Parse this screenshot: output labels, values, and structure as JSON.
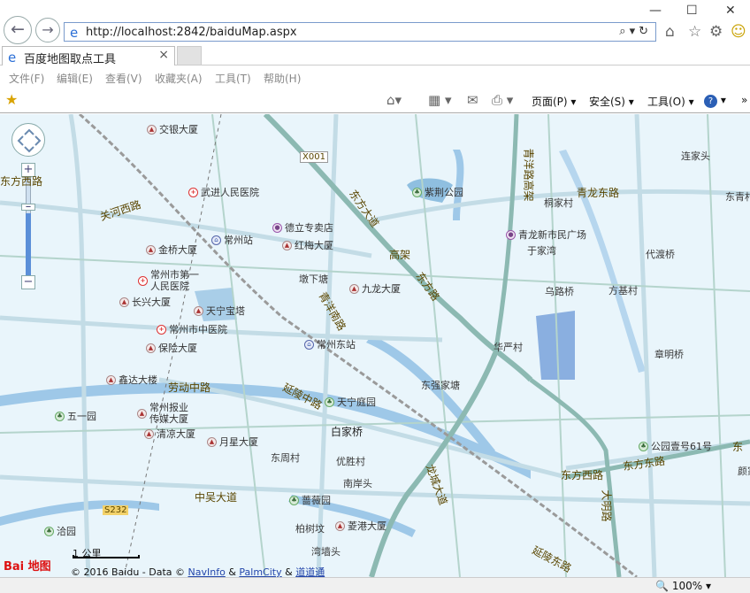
{
  "browser": {
    "url": "http://localhost:2842/baiduMap.aspx",
    "tab_title": "百度地图取点工具",
    "menu": [
      "文件(F)",
      "编辑(E)",
      "查看(V)",
      "收藏夹(A)",
      "工具(T)",
      "帮助(H)"
    ],
    "commands": {
      "page": "页面(P)",
      "safety": "安全(S)",
      "tools": "工具(O)",
      "help": "?"
    },
    "zoom": "100%"
  },
  "map": {
    "district_labels": [
      {
        "text": "交银大厦",
        "type": "poi",
        "pin": "bldg"
      },
      {
        "text": "武进人民医院",
        "type": "poi",
        "pin": "hosp"
      },
      {
        "text": "德立专卖店",
        "type": "poi",
        "pin": "shop"
      },
      {
        "text": "红梅大厦",
        "type": "poi",
        "pin": "bldg"
      },
      {
        "text": "常州站",
        "type": "poi",
        "pin": "tran"
      },
      {
        "text": "金桥大厦",
        "type": "poi",
        "pin": "bldg"
      },
      {
        "text": "常州市第一人民医院",
        "type": "poi",
        "pin": "hosp"
      },
      {
        "text": "长兴大厦",
        "type": "poi",
        "pin": "bldg"
      },
      {
        "text": "天宁宝塔",
        "type": "poi",
        "pin": "bldg"
      },
      {
        "text": "常州市中医院",
        "type": "poi",
        "pin": "hosp"
      },
      {
        "text": "保险大厦",
        "type": "poi",
        "pin": "bldg"
      },
      {
        "text": "九龙大厦",
        "type": "poi",
        "pin": "bldg"
      },
      {
        "text": "常州东站",
        "type": "poi",
        "pin": "tran"
      },
      {
        "text": "紫荆公园",
        "type": "poi",
        "pin": "park"
      },
      {
        "text": "青龙新市民广场",
        "type": "poi",
        "pin": "shop"
      },
      {
        "text": "鑫达大楼",
        "type": "poi",
        "pin": "bldg"
      },
      {
        "text": "五一园",
        "type": "poi",
        "pin": "park"
      },
      {
        "text": "常州报业传媒大厦",
        "type": "poi",
        "pin": "bldg"
      },
      {
        "text": "清凉大厦",
        "type": "poi",
        "pin": "bldg"
      },
      {
        "text": "月星大厦",
        "type": "poi",
        "pin": "bldg"
      },
      {
        "text": "天宁庭园",
        "type": "poi",
        "pin": "park"
      },
      {
        "text": "公园壹号61号",
        "type": "poi",
        "pin": "park"
      },
      {
        "text": "蔷薇园",
        "type": "poi",
        "pin": "park"
      },
      {
        "text": "菱港大厦",
        "type": "poi",
        "pin": "bldg"
      },
      {
        "text": "洽园",
        "type": "poi",
        "pin": "park"
      }
    ],
    "places": [
      "连家头",
      "东青村",
      "桐家村",
      "于家湾",
      "代渡桥",
      "乌路桥",
      "方基村",
      "墩下塘",
      "华严村",
      "章明桥",
      "东强家塘",
      "白家桥",
      "东周村",
      "优胜村",
      "南岸头",
      "柏树坟",
      "湾墙头",
      "颜家"
    ],
    "roads": [
      "关河西路",
      "劳动中路",
      "延陵中路",
      "中吴大道",
      "东方西路",
      "东方东路",
      "青龙东路",
      "青洋路高架",
      "东方大道",
      "延陵东路",
      "大明路",
      "龙城大道",
      "东方西路",
      "X001",
      "S232",
      "高架",
      "东方路",
      "青洋南路",
      "东"
    ],
    "scale_label": "1 公里",
    "copyright": {
      "text": "© 2016 Baidu - Data ©",
      "links": [
        "NavInfo",
        "PalmCity",
        "道道通"
      ],
      "sep": "&"
    },
    "logo": "Bai 地图"
  }
}
